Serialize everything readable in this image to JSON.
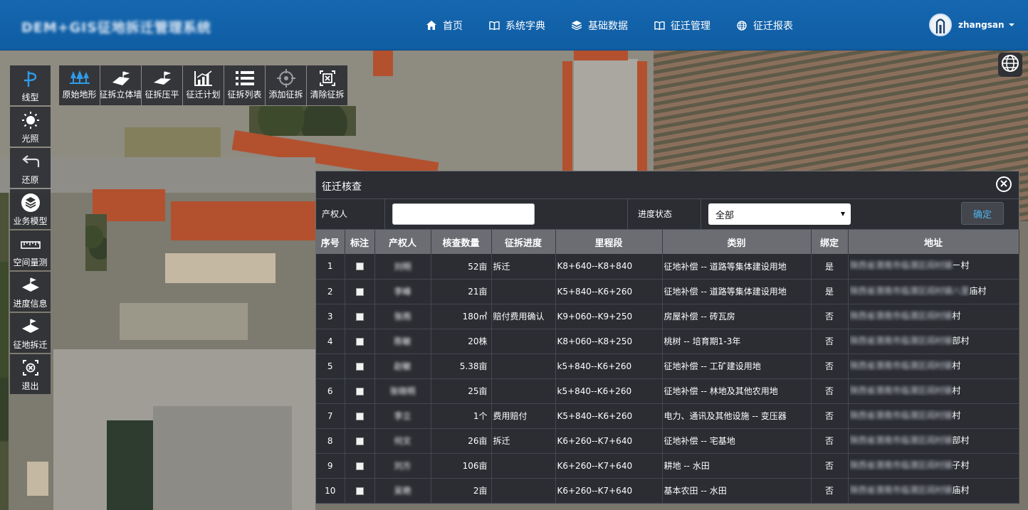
{
  "app": {
    "logo_text": "DEM+GIS征地拆迁管理系统"
  },
  "nav": [
    {
      "label": "首页",
      "icon": "home-icon"
    },
    {
      "label": "系统字典",
      "icon": "book-icon"
    },
    {
      "label": "基础数据",
      "icon": "layers-icon"
    },
    {
      "label": "征迁管理",
      "icon": "book-icon"
    },
    {
      "label": "征迁报表",
      "icon": "globe-icon"
    }
  ],
  "user": {
    "name": "zhangsan"
  },
  "left_tools": [
    {
      "label": "线型",
      "icon": "line-style-icon"
    },
    {
      "label": "光照",
      "icon": "sun-icon"
    },
    {
      "label": "还原",
      "icon": "undo-icon"
    },
    {
      "label": "业务模型",
      "icon": "layers-icon"
    },
    {
      "label": "空间量测",
      "icon": "ruler-icon"
    },
    {
      "label": "进度信息",
      "icon": "terrain-flag-icon"
    },
    {
      "label": "征地拆迁",
      "icon": "terrain-flag-icon"
    },
    {
      "label": "退出",
      "icon": "exit-icon"
    }
  ],
  "top_tools": [
    {
      "label": "原始地形",
      "icon": "tree-terrain-icon"
    },
    {
      "label": "征拆立体墙",
      "icon": "wall-icon"
    },
    {
      "label": "征拆压平",
      "icon": "flatten-icon"
    },
    {
      "label": "征迁计划",
      "icon": "chart-icon"
    },
    {
      "label": "征拆列表",
      "icon": "list-icon"
    },
    {
      "label": "添加征拆",
      "icon": "target-icon"
    },
    {
      "label": "清除征拆",
      "icon": "clear-icon"
    }
  ],
  "dialog": {
    "title": "征迁核查",
    "filter": {
      "owner_label": "产权人",
      "owner_value": "",
      "status_label": "进度状态",
      "status_value": "全部",
      "confirm_label": "确定"
    },
    "columns": [
      "序号",
      "标注",
      "产权人",
      "核查数量",
      "征拆进度",
      "里程段",
      "类别",
      "绑定",
      "地址"
    ],
    "rows": [
      {
        "no": "1",
        "owner": "刘明",
        "qty": "52亩",
        "progress": "拆迁",
        "segment": "K8+640--K8+840",
        "category": "征地补偿 -- 道路等集体建设用地",
        "bound": "是",
        "addr_hidden": "陕西省渭南市临渭区阎村镇",
        "addr_tail": "ㄧ村"
      },
      {
        "no": "2",
        "owner": "李峰",
        "qty": "21亩",
        "progress": "",
        "segment": "K5+840--K6+260",
        "category": "征地补偿 -- 道路等集体建设用地",
        "bound": "是",
        "addr_hidden": "陕西省渭南市临渭区阎村镇八里",
        "addr_tail": "庙村"
      },
      {
        "no": "3",
        "owner": "张雨",
        "qty": "180㎡",
        "progress": "赔付费用确认",
        "segment": "K9+060--K9+250",
        "category": "房屋补偿 -- 砖瓦房",
        "bound": "否",
        "addr_hidden": "陕西省渭南市临渭区阎村镇",
        "addr_tail": "村"
      },
      {
        "no": "4",
        "owner": "陈敏",
        "qty": "20株",
        "progress": "",
        "segment": "K8+060--K8+250",
        "category": "桃树 -- 培育期1-3年",
        "bound": "否",
        "addr_hidden": "陕西省渭南市临渭区阎村镇",
        "addr_tail": "部村"
      },
      {
        "no": "5",
        "owner": "赵敏",
        "qty": "5.38亩",
        "progress": "",
        "segment": "k5+840--K6+260",
        "category": "征地补偿 -- 工矿建设用地",
        "bound": "否",
        "addr_hidden": "陕西省渭南市临渭区阎村镇",
        "addr_tail": "村"
      },
      {
        "no": "6",
        "owner": "张晓明",
        "qty": "25亩",
        "progress": "",
        "segment": "k5+840--K6+260",
        "category": "征地补偿 -- 林地及其他农用地",
        "bound": "否",
        "addr_hidden": "陕西省渭南市临渭区阎村镇",
        "addr_tail": "村"
      },
      {
        "no": "7",
        "owner": "李立",
        "qty": "1个",
        "progress": "费用赔付",
        "segment": "K5+840--K6+260",
        "category": "电力、通讯及其他设施 -- 变压器",
        "bound": "否",
        "addr_hidden": "陕西省渭南市临渭区阎村镇",
        "addr_tail": "村"
      },
      {
        "no": "8",
        "owner": "何文",
        "qty": "26亩",
        "progress": "拆迁",
        "segment": "K6+260--K7+640",
        "category": "征地补偿 -- 宅基地",
        "bound": "否",
        "addr_hidden": "陕西省渭南市临渭区阎村镇",
        "addr_tail": "部村"
      },
      {
        "no": "9",
        "owner": "刘方",
        "qty": "106亩",
        "progress": "",
        "segment": "K6+260--K7+640",
        "category": "耕地 -- 水田",
        "bound": "否",
        "addr_hidden": "陕西省渭南市临渭区阎村镇",
        "addr_tail": "子村"
      },
      {
        "no": "10",
        "owner": "吴艳",
        "qty": "2亩",
        "progress": "",
        "segment": "K6+260--K7+640",
        "category": "基本农田 -- 水田",
        "bound": "否",
        "addr_hidden": "陕西省渭南市临渭区阎村镇",
        "addr_tail": "庙村"
      }
    ]
  }
}
